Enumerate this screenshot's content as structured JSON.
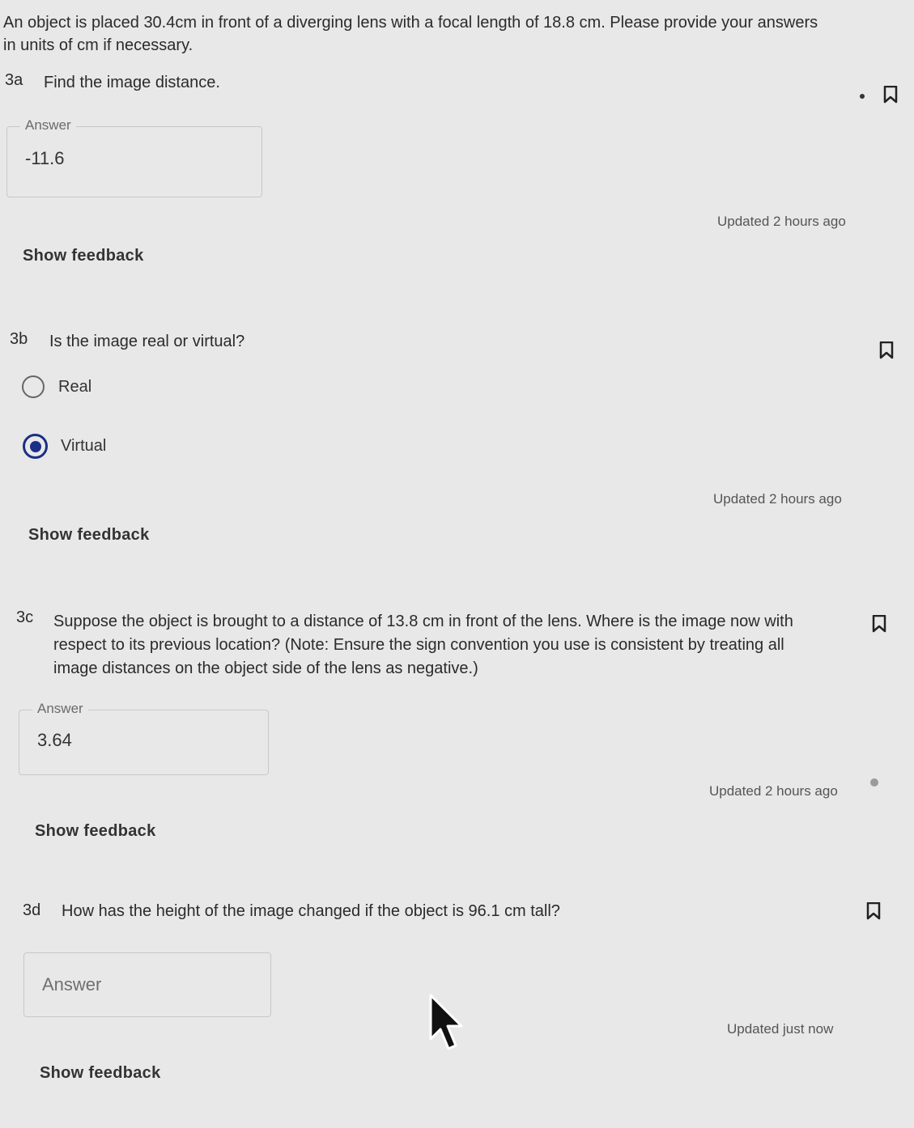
{
  "intro": "An object is placed 30.4cm in front of a diverging lens with a focal length of 18.8 cm. Please provide your answers in units of cm if necessary.",
  "q3a": {
    "number": "3a",
    "text": "Find the image distance.",
    "answer_label": "Answer",
    "answer_value": "-11.6",
    "updated": "Updated 2 hours ago",
    "feedback": "Show feedback"
  },
  "q3b": {
    "number": "3b",
    "text": "Is the image real or virtual?",
    "options": [
      {
        "label": "Real",
        "selected": false
      },
      {
        "label": "Virtual",
        "selected": true
      }
    ],
    "updated": "Updated 2 hours ago",
    "feedback": "Show feedback"
  },
  "q3c": {
    "number": "3c",
    "text_lines": [
      "Suppose the object is brought to a distance of 13.8 cm in front of the lens. Where is the image now with",
      "respect to its previous location? (Note: Ensure the sign convention you use is consistent by treating all",
      "image distances on the object side of the lens as negative.)"
    ],
    "answer_label": "Answer",
    "answer_value": "3.64",
    "updated": "Updated 2 hours ago",
    "feedback": "Show feedback"
  },
  "q3d": {
    "number": "3d",
    "text": "How has the height of the image changed if the object is 96.1 cm tall?",
    "answer_placeholder": "Answer",
    "updated": "Updated just now",
    "feedback": "Show feedback"
  },
  "colors": {
    "background": "#e9e8e8",
    "radio_selected": "#1a2f86",
    "text": "#2b2b2b"
  },
  "icons": [
    "bookmark-flag-icon",
    "mouse-cursor-icon"
  ]
}
